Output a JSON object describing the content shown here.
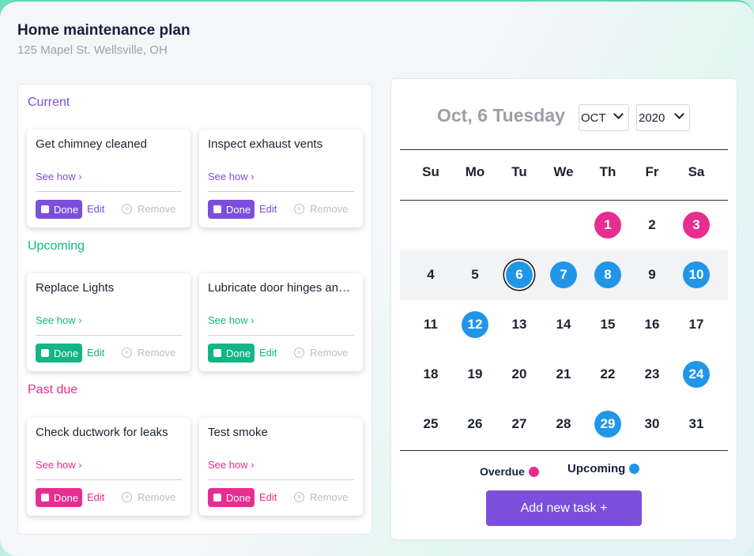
{
  "header": {
    "title": "Home maintenance plan",
    "address": "125 Mapel St. Wellsville, OH"
  },
  "sections": {
    "current": {
      "label": "Current",
      "tasks": [
        {
          "title": "Get chimney cleaned",
          "see_how": "See how",
          "done": "Done",
          "edit": "Edit",
          "remove": "Remove"
        },
        {
          "title": "Inspect exhaust vents",
          "see_how": "See how",
          "done": "Done",
          "edit": "Edit",
          "remove": "Remove"
        }
      ]
    },
    "upcoming": {
      "label": "Upcoming",
      "tasks": [
        {
          "title": "Replace Lights",
          "see_how": "See how",
          "done": "Done",
          "edit": "Edit",
          "remove": "Remove"
        },
        {
          "title": "Lubricate door hinges and locks",
          "see_how": "See how",
          "done": "Done",
          "edit": "Edit",
          "remove": "Remove"
        }
      ]
    },
    "past_due": {
      "label": "Past due",
      "tasks": [
        {
          "title": "Check ductwork for leaks",
          "see_how": "See how",
          "done": "Done",
          "edit": "Edit",
          "remove": "Remove"
        },
        {
          "title": "Test smoke",
          "see_how": "See how",
          "done": "Done",
          "edit": "Edit",
          "remove": "Remove"
        }
      ]
    }
  },
  "calendar": {
    "selected_date_label": "Oct, 6 Tuesday",
    "month_select": "OCT",
    "year_select": "2020",
    "weekdays": [
      "Su",
      "Mo",
      "Tu",
      "We",
      "Th",
      "Fr",
      "Sa"
    ],
    "first_weekday_index": 4,
    "days_in_month": 31,
    "today": 6,
    "overdue_days": [
      1,
      3
    ],
    "upcoming_days": [
      6,
      7,
      8,
      10,
      12,
      24,
      29
    ],
    "highlighted_week": 1
  },
  "legend": {
    "overdue": "Overdue",
    "upcoming": "Upcoming"
  },
  "actions": {
    "add_task": "Add new task +"
  },
  "colors": {
    "purple": "#7b4fdc",
    "green": "#13b584",
    "pink": "#e72d8f",
    "blue": "#2196e8"
  },
  "icons": {
    "chevron": "chevron-right-icon",
    "remove": "x-circle-icon",
    "dropdown": "chevron-down-icon"
  }
}
